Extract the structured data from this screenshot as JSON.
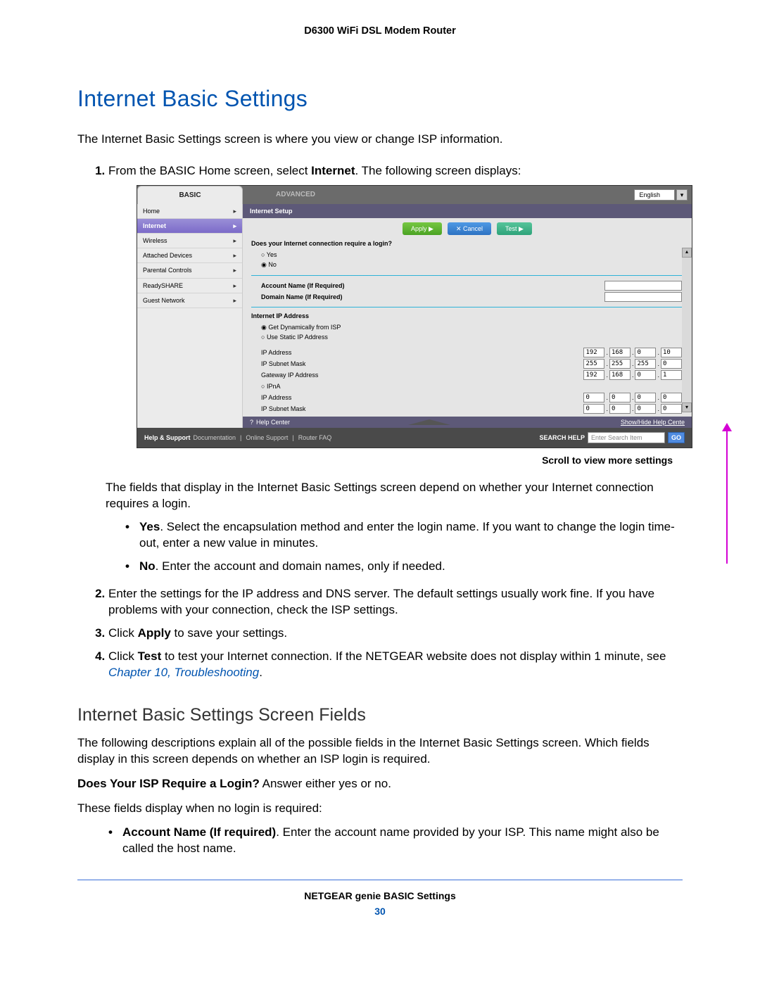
{
  "header": {
    "product": "D6300 WiFi DSL Modem Router"
  },
  "title": "Internet Basic Settings",
  "intro": "The Internet Basic Settings screen is where you view or change ISP information.",
  "steps": {
    "s1_pre": "From the BASIC Home screen, select ",
    "s1_bold": "Internet",
    "s1_post": ". The following screen displays:",
    "s_after_shot": "The fields that display in the Internet Basic Settings screen depend on whether your Internet connection requires a login.",
    "bullet_yes_label": "Yes",
    "bullet_yes_text": ". Select the encapsulation method and enter the login name. If you want to change the login time-out, enter a new value in minutes.",
    "bullet_no_label": "No",
    "bullet_no_text": ". Enter the account and domain names, only if needed.",
    "s2": "Enter the settings for the IP address and DNS server. The default settings usually work fine. If you have problems with your connection, check the ISP settings.",
    "s3_pre": "Click ",
    "s3_bold": "Apply",
    "s3_post": " to save your settings.",
    "s4_pre": "Click ",
    "s4_bold": "Test",
    "s4_mid": " to test your Internet connection. If the NETGEAR website does not display within 1 minute, see ",
    "s4_link": "Chapter 10, Troubleshooting",
    "s4_end": "."
  },
  "caption_scroll": "Scroll to view more settings",
  "subsection": "Internet Basic Settings Screen Fields",
  "sub_p1": "The following descriptions explain all of the possible fields in the Internet Basic Settings screen. Which fields display in this screen depends on whether an ISP login is required.",
  "sub_p2_bold": "Does Your ISP Require a Login?",
  "sub_p2_rest": " Answer either yes or no.",
  "sub_p3": "These fields display when no login is required:",
  "sub_bullet_bold": "Account Name (If required)",
  "sub_bullet_text": ". Enter the account name provided by your ISP. This name might also be called the host name.",
  "footer": {
    "chapter": "NETGEAR genie BASIC Settings",
    "page": "30"
  },
  "shot": {
    "tab_basic": "BASIC",
    "tab_advanced": "ADVANCED",
    "language": "English",
    "nav": [
      "Home",
      "Internet",
      "Wireless",
      "Attached Devices",
      "Parental Controls",
      "ReadySHARE",
      "Guest Network"
    ],
    "nav_active_index": 1,
    "panel_title": "Internet Setup",
    "btn_apply": "Apply ▶",
    "btn_cancel": "✕ Cancel",
    "btn_test": "Test ▶",
    "question": "Does your Internet connection require a login?",
    "opt_yes": "Yes",
    "opt_no": "No",
    "acct_lbl": "Account Name  (If Required)",
    "domain_lbl": "Domain Name  (If Required)",
    "ip_section": "Internet IP Address",
    "ip_dyn": "Get Dynamically from ISP",
    "ip_static": "Use Static IP Address",
    "ip_addr_lbl": "IP Address",
    "ip_mask_lbl": "IP Subnet Mask",
    "ip_gw_lbl": "Gateway IP Address",
    "ip_pna": "IPnA",
    "ip_pna_addr": "IP Address",
    "ip_pna_mask": "IP Subnet Mask",
    "ip1": [
      "192",
      "168",
      "0",
      "10"
    ],
    "ip2": [
      "255",
      "255",
      "255",
      "0"
    ],
    "ip3": [
      "192",
      "168",
      "0",
      "1"
    ],
    "ip4": [
      "0",
      "0",
      "0",
      "0"
    ],
    "ip5": [
      "0",
      "0",
      "0",
      "0"
    ],
    "help_center": "Help Center",
    "help_toggle": "Show/Hide Help Cente",
    "footer_label": "Help & Support",
    "footer_doc": "Documentation",
    "footer_online": "Online Support",
    "footer_faq": "Router FAQ",
    "footer_search_lbl": "SEARCH HELP",
    "footer_search_ph": "Enter Search Item",
    "footer_go": "GO"
  }
}
